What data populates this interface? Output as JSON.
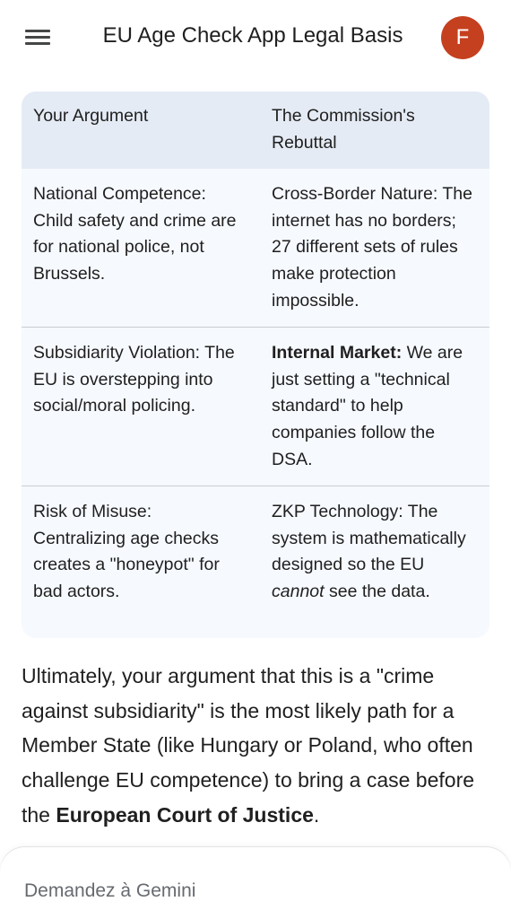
{
  "header": {
    "menu_icon": "hamburger-menu-icon",
    "title": "EU Age Check App Legal Basis",
    "avatar_letter": "F",
    "avatar_color": "#c5401f"
  },
  "table": {
    "headers": [
      "Your Argument",
      "The Commission's Rebuttal"
    ],
    "rows": [
      {
        "argument_title": "National Competence:",
        "argument_text": " Child safety and crime are for national police, not Brussels.",
        "rebuttal_title": "Cross-Border Nature:",
        "rebuttal_text": " The internet has no borders; 27 different sets of rules make protection impossible."
      },
      {
        "argument_title": "Subsidiarity Violation:",
        "argument_text": " The EU is overstepping into social/moral policing.",
        "rebuttal_title": "Internal Market:",
        "rebuttal_text": " We are just setting a \"technical standard\" to help companies follow the DSA."
      },
      {
        "argument_title": "Risk of Misuse:",
        "argument_text": " Centralizing age checks creates a \"honeypot\" for bad actors.",
        "rebuttal_title": "ZKP Technology:",
        "rebuttal_text_before": " The system is mathematically designed so the EU ",
        "rebuttal_text_em": "cannot",
        "rebuttal_text_after": " see the data."
      }
    ]
  },
  "paragraph": {
    "text_before": "Ultimately, your argument that this is a \"crime against subsidiarity\" is the most likely path for a Member State (like Hungary or Poland, who often challenge EU competence) to bring a case before the ",
    "bold": "European Court of Justice",
    "text_after": "."
  },
  "composer": {
    "placeholder": "Demandez à Gemini"
  }
}
